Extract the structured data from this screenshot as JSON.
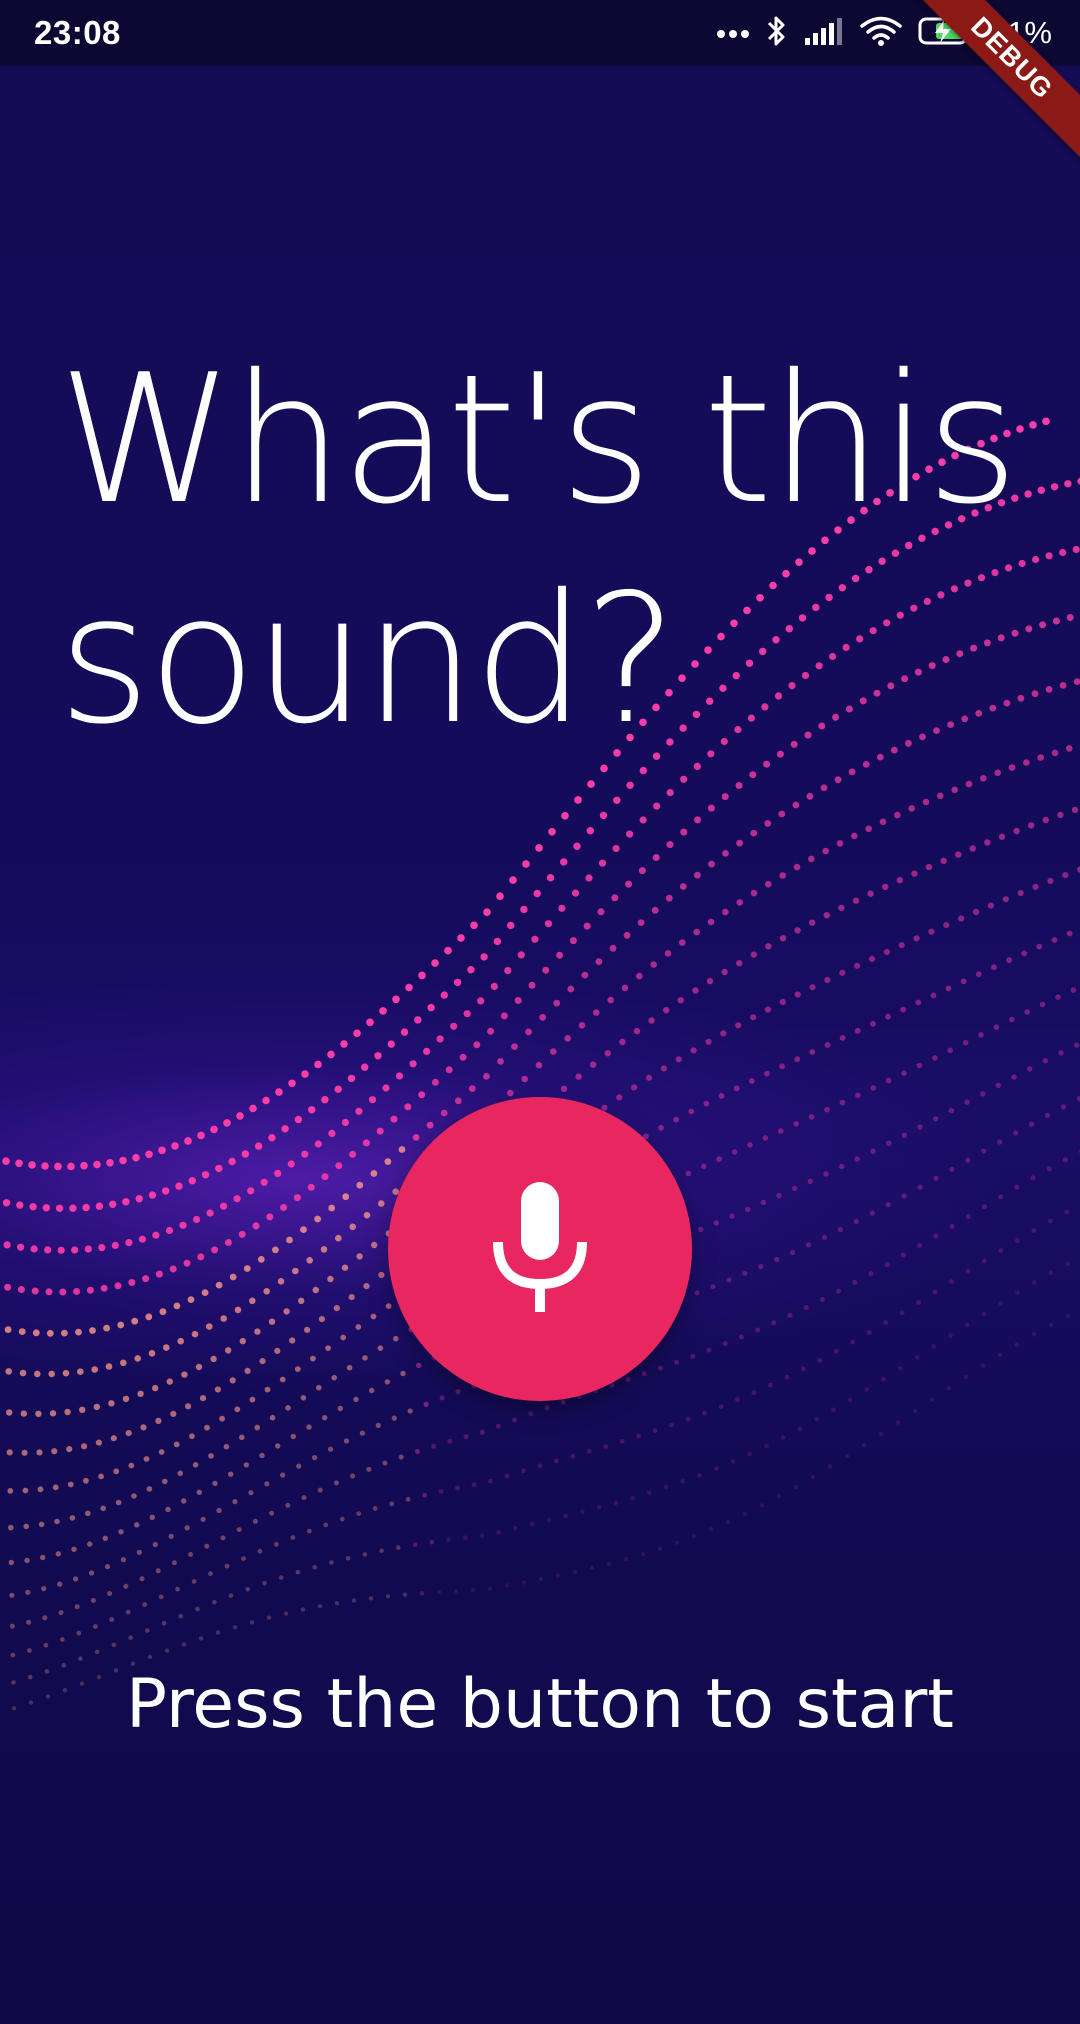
{
  "status_bar": {
    "time": "23:08",
    "battery_percent": "71%",
    "icons": [
      "more-dots-icon",
      "bluetooth-icon",
      "cellular-signal-icon",
      "wifi-icon",
      "battery-charging-icon"
    ]
  },
  "debug_banner": {
    "label": "DEBUG",
    "color": "#8b1a17"
  },
  "headline": {
    "line1": "What's this",
    "line2": "sound?"
  },
  "mic_button": {
    "icon": "microphone-icon",
    "color": "#e8265f"
  },
  "prompt": "Press the button to start",
  "colors": {
    "background": "#140b5a",
    "wave_pink": "#ff3da8",
    "wave_peach": "#ff9a8c"
  }
}
